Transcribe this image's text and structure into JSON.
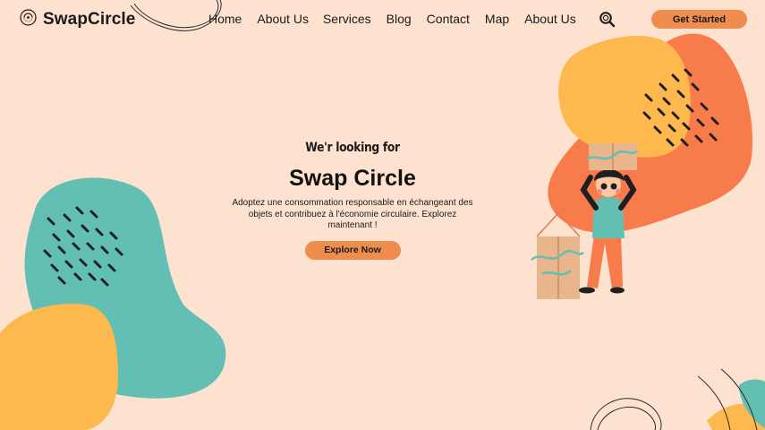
{
  "header": {
    "brand": "SwapCircle",
    "logo_icon": "recycle-circle-icon",
    "nav": [
      {
        "label": "Home"
      },
      {
        "label": "About Us"
      },
      {
        "label": "Services"
      },
      {
        "label": "Blog"
      },
      {
        "label": "Contact"
      },
      {
        "label": "Map"
      },
      {
        "label": "About Us"
      }
    ],
    "search_icon": "search-icon",
    "cta_label": "Get Started"
  },
  "hero": {
    "eyebrow": "We'r looking for",
    "title": "Swap Circle",
    "subtitle": "Adoptez une consommation responsable en échangeant des objets et contribuez à l'économie circulaire. Explorez maintenant !",
    "button_label": "Explore Now"
  },
  "colors": {
    "background": "#fde2cf",
    "accent": "#ee8d4e",
    "teal": "#63bfb4",
    "yellow": "#fdb94e",
    "orange": "#f87b4c"
  }
}
